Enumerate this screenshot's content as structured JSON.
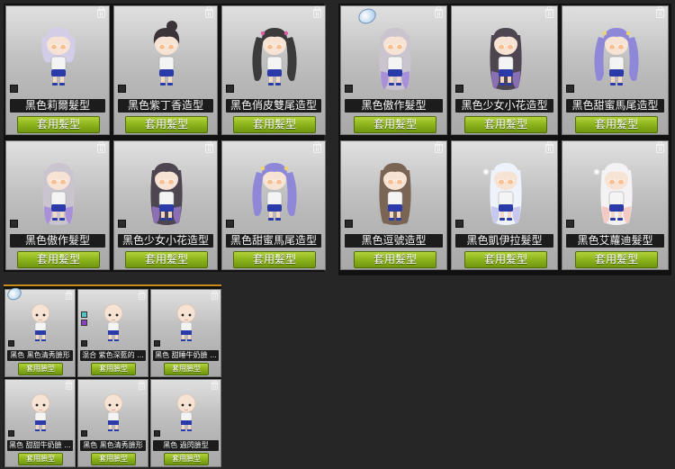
{
  "panels": {
    "hair_a": {
      "cards": [
        {
          "name": "黑色莉爾髮型",
          "hair": "#d4cde8",
          "style": "bob"
        },
        {
          "name": "黑色紫丁香造型",
          "hair": "#3a3438",
          "style": "bun"
        },
        {
          "name": "黑色俏皮雙尾造型",
          "hair": "#3b3b3b",
          "style": "twin",
          "accent": "#e25aa3"
        },
        {
          "name": "黑色傲作髮型",
          "hair": "#c9c4ce",
          "style": "long",
          "tip": "#a991d9"
        },
        {
          "name": "黑色少女小花造型",
          "hair": "#4d4550",
          "style": "wave",
          "tip": "#8a6fb5"
        },
        {
          "name": "黑色甜蜜馬尾造型",
          "hair": "#8f88d8",
          "style": "twin",
          "accent": "#f0d46b"
        }
      ],
      "button_label": "套用髮型"
    },
    "hair_b": {
      "cards": [
        {
          "name": "黑色傲作髮型",
          "hair": "#c9c4ce",
          "style": "long",
          "tip": "#a991d9"
        },
        {
          "name": "黑色少女小花造型",
          "hair": "#4d4550",
          "style": "wave",
          "tip": "#8a6fb5"
        },
        {
          "name": "黑色甜蜜馬尾造型",
          "hair": "#8f88d8",
          "style": "twin",
          "accent": "#f0d46b"
        },
        {
          "name": "黑色逗號造型",
          "hair": "#7a6555",
          "style": "wave"
        },
        {
          "name": "黑色凱伊拉髮型",
          "hair": "#eef2fb",
          "style": "long",
          "tip": "#c7c8f0"
        },
        {
          "name": "黑色艾蘿迪髮型",
          "hair": "#f4f2f4",
          "style": "wave",
          "tip": "#f4c9c4"
        }
      ],
      "button_label": "套用髮型"
    },
    "face": {
      "cards": [
        {
          "name": "黑色 黑色清秀臉形"
        },
        {
          "name": "混合 紫色深藍的 ...",
          "swatches": [
            "#57c2c6",
            "#8d3fc4"
          ]
        },
        {
          "name": "黑色 甜睡牛奶臉 ..."
        },
        {
          "name": "黑色 甜甜牛奶臉 ..."
        },
        {
          "name": "黑色 黑色清秀臉形"
        },
        {
          "name": "黑色 過閃臉型"
        }
      ],
      "button_label": "套用臉型"
    }
  },
  "icons": {
    "trash": "trash-icon",
    "select": "select-checkbox",
    "badge": "favorite-badge-icon"
  },
  "colors": {
    "button": "#8cb21c",
    "panel_border": "#111111",
    "accent_border": "#c98a1a"
  }
}
